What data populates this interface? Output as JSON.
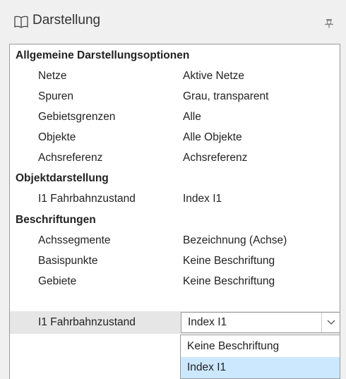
{
  "panel": {
    "title": "Darstellung",
    "icon": "book-icon",
    "pin_icon": "pin-icon"
  },
  "grid": {
    "categories": [
      {
        "label": "Allgemeine Darstellungsoptionen",
        "rows": [
          {
            "name": "Netze",
            "value": "Aktive Netze"
          },
          {
            "name": "Spuren",
            "value": "Grau, transparent"
          },
          {
            "name": "Gebietsgrenzen",
            "value": "Alle"
          },
          {
            "name": "Objekte",
            "value": "Alle Objekte"
          },
          {
            "name": "Achsreferenz",
            "value": "Achsreferenz"
          }
        ]
      },
      {
        "label": "Objektdarstellung",
        "rows": [
          {
            "name": "I1 Fahrbahnzustand",
            "value": "Index I1"
          }
        ]
      },
      {
        "label": "Beschriftungen",
        "rows": [
          {
            "name": "Achssegmente",
            "value": "Bezeichnung (Achse)"
          },
          {
            "name": "Basispunkte",
            "value": "Keine Beschriftung"
          },
          {
            "name": "Gebiete",
            "value": "Keine Beschriftung"
          },
          {
            "name": "I1 Fahrbahnzustand",
            "value": "Index I1"
          }
        ]
      }
    ]
  },
  "dropdown": {
    "options": [
      "Keine Beschriftung",
      "Index I1"
    ],
    "selected": "Index I1"
  },
  "colors": {
    "selected_row": "#e6e6e6",
    "selected_option": "#cce8ff",
    "border": "#9a9a9a"
  }
}
